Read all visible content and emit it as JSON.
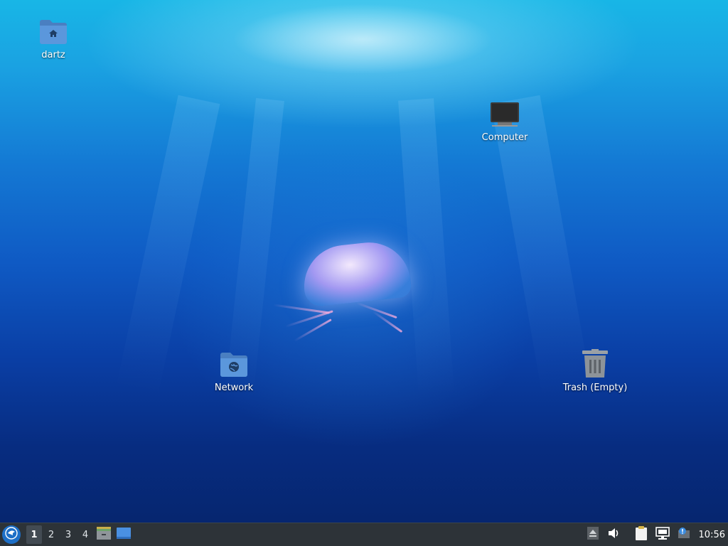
{
  "desktop": {
    "icons": {
      "home": {
        "label": "dartz",
        "icon": "home-folder-icon"
      },
      "computer": {
        "label": "Computer",
        "icon": "computer-icon"
      },
      "network": {
        "label": "Network",
        "icon": "network-folder-icon"
      },
      "trash": {
        "label": "Trash (Empty)",
        "icon": "trash-icon"
      }
    }
  },
  "taskbar": {
    "start_icon": "menu-icon",
    "workspaces": [
      "1",
      "2",
      "3",
      "4"
    ],
    "active_workspace": "1",
    "launchers": [
      {
        "icon": "file-manager-icon"
      },
      {
        "icon": "show-desktop-icon"
      }
    ],
    "tray": [
      {
        "icon": "eject-icon"
      },
      {
        "icon": "volume-icon"
      },
      {
        "icon": "clipboard-icon"
      },
      {
        "icon": "network-icon"
      },
      {
        "icon": "update-notifier-icon"
      }
    ],
    "clock": "10:56"
  }
}
